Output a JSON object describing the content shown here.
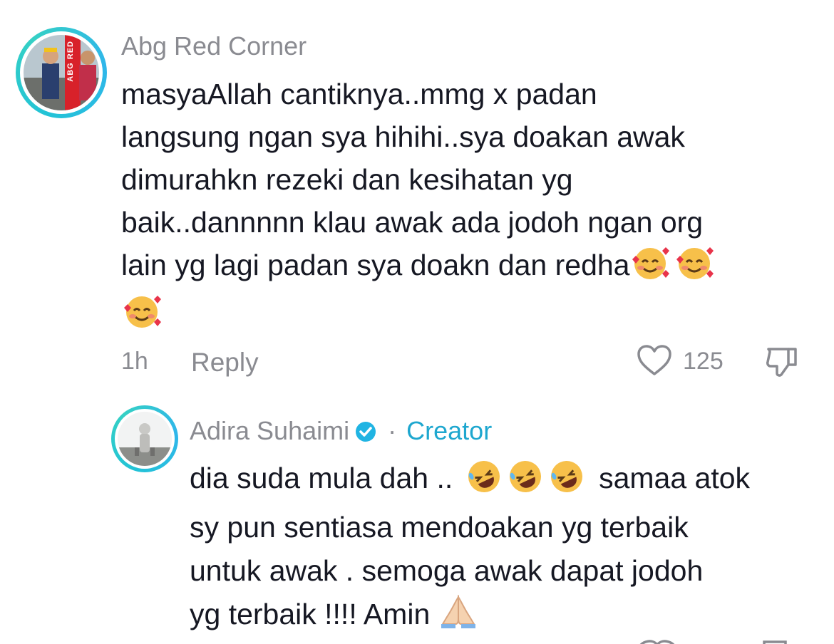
{
  "comment": {
    "username": "Abg Red Corner",
    "text_lines": [
      "masyaAllah cantiknya..mmg x padan",
      "langsung ngan sya hihihi..sya doakan awak",
      "dimurahkn rezeki dan kesihatan yg",
      "baik..dannnnn klau awak ada jodoh ngan org",
      "lain yg lagi padan sya doakn dan redha"
    ],
    "time": "1h",
    "reply_label": "Reply",
    "like_count": "125",
    "avatar_label": "ABG RED"
  },
  "reply": {
    "username": "Adira Suhaimi",
    "separator": "·",
    "creator_label": "Creator",
    "line1_start": "dia suda mula dah ..",
    "line1_end": "samaa atok",
    "text_lines": [
      "sy pun sentiasa mendoakan yg terbaik",
      "untuk awak . semoga awak dapat jodoh"
    ],
    "last_line": "yg terbaik !!!! Amin"
  },
  "colors": {
    "ring": "#22c3d6",
    "creator": "#1ea7cf",
    "muted": "#8a8b91",
    "text": "#161823"
  },
  "icons": [
    "heart-icon",
    "dislike-icon",
    "verified-badge-icon",
    "smiling-face-with-hearts-emoji",
    "rofl-emoji",
    "folded-hands-emoji"
  ]
}
